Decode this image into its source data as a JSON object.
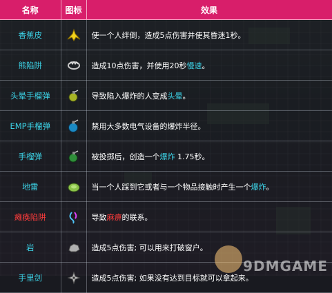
{
  "header": {
    "name": "名称",
    "icon": "图标",
    "effect": "效果"
  },
  "rows": [
    {
      "name": "香蕉皮",
      "name_color": "#3cd2e6",
      "icon": "banana-peel-icon",
      "effect": [
        {
          "t": "使一个人绊倒，造成5点伤害并使其昏迷1秒。"
        }
      ]
    },
    {
      "name": "熊陷阱",
      "name_color": "#3cd2e6",
      "icon": "bear-trap-icon",
      "effect": [
        {
          "t": "造成10点伤害，并使用20秒"
        },
        {
          "t": "慢速",
          "c": "cyan"
        },
        {
          "t": "。"
        }
      ]
    },
    {
      "name": "头晕手榴弹",
      "name_color": "#3cd2e6",
      "icon": "dizzy-grenade-icon",
      "effect": [
        {
          "t": "导致陷入爆炸的人变成"
        },
        {
          "t": "头晕",
          "c": "cyan"
        },
        {
          "t": "。"
        }
      ]
    },
    {
      "name": "EMP手榴弹",
      "name_color": "#3cd2e6",
      "icon": "emp-grenade-icon",
      "effect": [
        {
          "t": "禁用大多数电气设备的爆炸半径。"
        }
      ]
    },
    {
      "name": "手榴弹",
      "name_color": "#3cd2e6",
      "icon": "grenade-icon",
      "effect": [
        {
          "t": "被投掷后，创造一个"
        },
        {
          "t": "爆炸",
          "c": "cyan"
        },
        {
          "t": " 1.75秒。"
        }
      ]
    },
    {
      "name": "地雷",
      "name_color": "#3cd2e6",
      "icon": "landmine-icon",
      "effect": [
        {
          "t": "当一个人踩到它或者与一个物品接触时产生一个"
        },
        {
          "t": "爆炸",
          "c": "cyan"
        },
        {
          "t": "。"
        }
      ]
    },
    {
      "name": "瘫痪陷阱",
      "name_color": "#ff3b3b",
      "icon": "paralysis-trap-icon",
      "effect": [
        {
          "t": "导致"
        },
        {
          "t": "麻痹",
          "c": "red"
        },
        {
          "t": "的联系。"
        }
      ]
    },
    {
      "name": "岩",
      "name_color": "#3cd2e6",
      "icon": "rock-icon",
      "effect": [
        {
          "t": "造成5点伤害; 可以用来打破窗户。"
        }
      ]
    },
    {
      "name": "手里剑",
      "name_color": "#3cd2e6",
      "icon": "shuriken-icon",
      "effect": [
        {
          "t": "造成5点伤害; 如果没有达到目标就可以拿起来。"
        }
      ]
    }
  ],
  "watermark": "9DMGAME"
}
